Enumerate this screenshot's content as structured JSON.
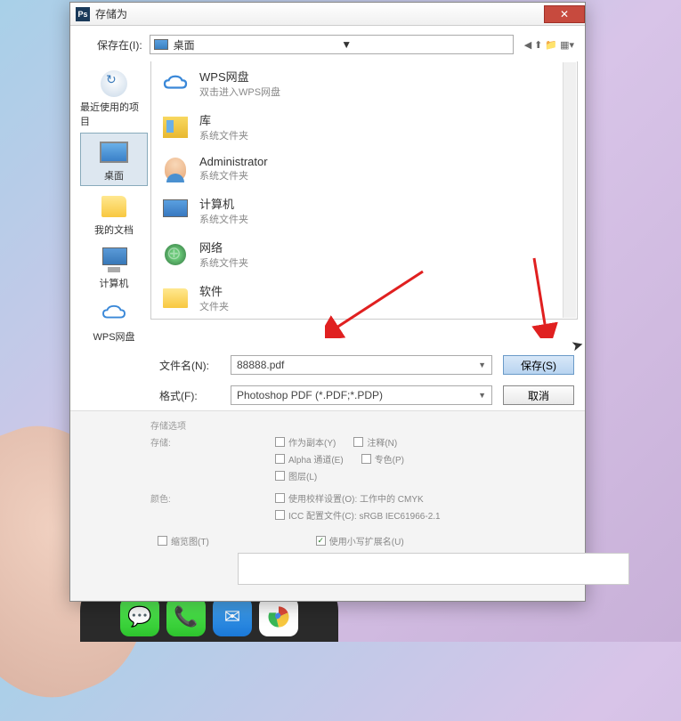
{
  "window": {
    "title": "存储为",
    "close": "✕"
  },
  "save_in": {
    "label": "保存在(I):",
    "location": "桌面"
  },
  "sidebar": {
    "items": [
      {
        "label": "最近使用的项目"
      },
      {
        "label": "桌面"
      },
      {
        "label": "我的文档"
      },
      {
        "label": "计算机"
      },
      {
        "label": "WPS网盘"
      }
    ]
  },
  "files": {
    "items": [
      {
        "name": "WPS网盘",
        "sub": "双击进入WPS网盘"
      },
      {
        "name": "库",
        "sub": "系统文件夹"
      },
      {
        "name": "Administrator",
        "sub": "系统文件夹"
      },
      {
        "name": "计算机",
        "sub": "系统文件夹"
      },
      {
        "name": "网络",
        "sub": "系统文件夹"
      },
      {
        "name": "软件",
        "sub": "文件夹"
      }
    ]
  },
  "filename": {
    "label": "文件名(N):",
    "value": "88888.pdf"
  },
  "format": {
    "label": "格式(F):",
    "value": "Photoshop PDF (*.PDF;*.PDP)"
  },
  "buttons": {
    "save": "保存(S)",
    "cancel": "取消"
  },
  "options": {
    "section_label": "存储选项",
    "storage": "存储:",
    "as_copy": "作为副本(Y)",
    "notes": "注释(N)",
    "alpha": "Alpha 通道(E)",
    "spot": "专色(P)",
    "layers": "图层(L)",
    "color": "颜色:",
    "proof": "使用校样设置(O): 工作中的 CMYK",
    "icc": "ICC 配置文件(C): sRGB IEC61966-2.1",
    "thumbnail": "缩览图(T)",
    "lowercase": "使用小写扩展名(U)"
  }
}
